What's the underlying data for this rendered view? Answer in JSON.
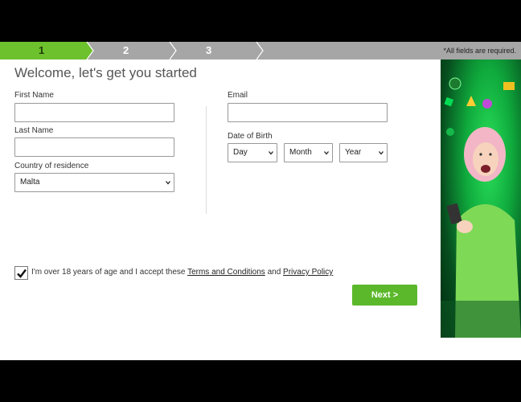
{
  "steps": [
    {
      "label": "1",
      "active": true
    },
    {
      "label": "2",
      "active": false
    },
    {
      "label": "3",
      "active": false
    }
  ],
  "required_note": "*All fields are required.",
  "page_title": "Welcome, let's get you started",
  "form": {
    "first_name": {
      "label": "First Name",
      "value": ""
    },
    "last_name": {
      "label": "Last Name",
      "value": ""
    },
    "country": {
      "label": "Country of residence",
      "value": "Malta"
    },
    "email": {
      "label": "Email",
      "value": ""
    },
    "dob": {
      "label": "Date of Birth",
      "day": "Day",
      "month": "Month",
      "year": "Year"
    }
  },
  "agreement": {
    "checked": true,
    "prefix": "I'm over 18 years of age and I accept these",
    "terms_link": "Terms and Conditions",
    "joiner": "and",
    "privacy_link": "Privacy Policy"
  },
  "next_button": "Next >",
  "colors": {
    "accent_green": "#6cc12d",
    "button_green": "#5bb82a",
    "stepbar_grey": "#a6a6a6"
  }
}
